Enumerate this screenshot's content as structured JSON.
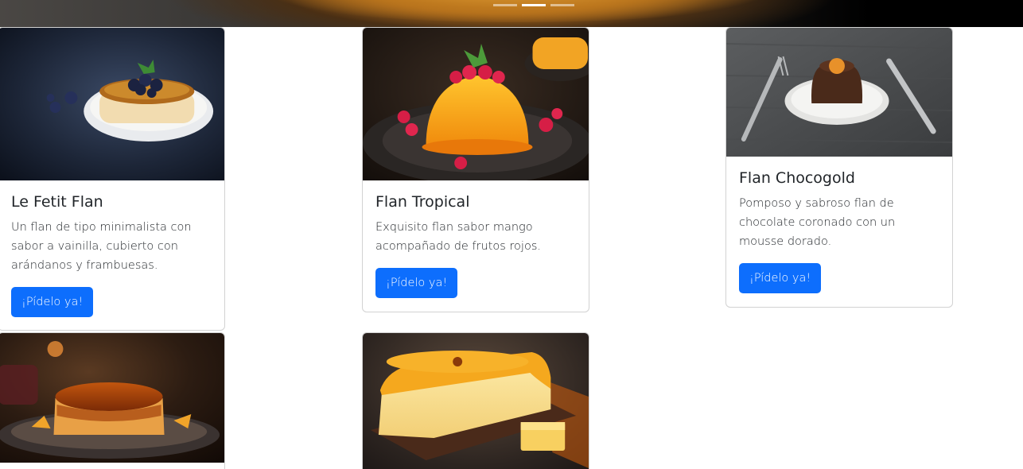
{
  "carousel": {
    "indicators": [
      {
        "active": false
      },
      {
        "active": true
      },
      {
        "active": false
      }
    ]
  },
  "cards": [
    {
      "title": "Le Fetit Flan",
      "text": "Un flan de tipo minimalista con sabor a vainilla, cubierto con arándanos y frambuesas.",
      "button": "¡Pídelo ya!"
    },
    {
      "title": "Flan Tropical",
      "text": "Exquisito flan sabor mango acompañado de frutos rojos.",
      "button": "¡Pídelo ya!"
    },
    {
      "title": "Flan Chocogold",
      "text": "Pomposo y sabroso flan de chocolate coronado con un mousse dorado.",
      "button": "¡Pídelo ya!"
    }
  ],
  "colors": {
    "button": "#0d6efd",
    "text": "#212529"
  }
}
